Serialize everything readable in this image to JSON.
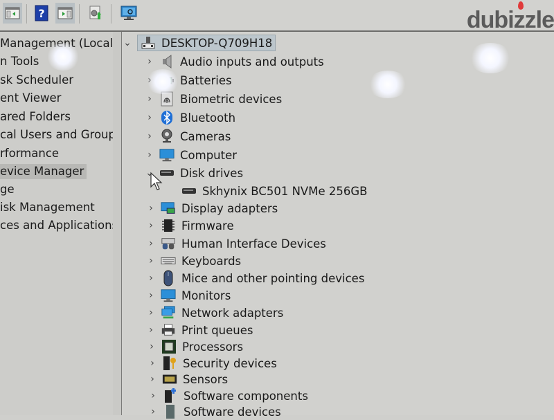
{
  "toolbar": {
    "buttons": [
      {
        "name": "show-hide-console-tree",
        "icon": "console-tree-icon"
      },
      {
        "name": "help",
        "icon": "help-icon"
      },
      {
        "name": "show-hide-action-pane",
        "icon": "action-pane-icon"
      },
      {
        "name": "update-driver",
        "icon": "update-driver-icon"
      },
      {
        "name": "scan-hardware-changes",
        "icon": "scan-hardware-icon"
      }
    ]
  },
  "watermark": "dubizzle",
  "left_tree": {
    "items": [
      {
        "label": "Management (Local)",
        "selected": false
      },
      {
        "label": "n Tools",
        "selected": false
      },
      {
        "label": "sk Scheduler",
        "selected": false
      },
      {
        "label": "ent Viewer",
        "selected": false
      },
      {
        "label": "ared Folders",
        "selected": false
      },
      {
        "label": "cal Users and Groups",
        "selected": false
      },
      {
        "label": "rformance",
        "selected": false
      },
      {
        "label": "evice Manager",
        "selected": true
      },
      {
        "label": "ge",
        "selected": false
      },
      {
        "label": "isk Management",
        "selected": false
      },
      {
        "label": "ces and Applications",
        "selected": false
      }
    ]
  },
  "device_tree": {
    "root": {
      "label": "DESKTOP-Q709H18",
      "expanded": true,
      "icon": "computer-root-icon"
    },
    "categories": [
      {
        "label": "Audio inputs and outputs",
        "icon": "speaker-icon",
        "expanded": false
      },
      {
        "label": "Batteries",
        "icon": "battery-icon",
        "expanded": false
      },
      {
        "label": "Biometric devices",
        "icon": "fingerprint-icon",
        "expanded": false
      },
      {
        "label": "Bluetooth",
        "icon": "bluetooth-icon",
        "expanded": false
      },
      {
        "label": "Cameras",
        "icon": "webcam-icon",
        "expanded": false
      },
      {
        "label": "Computer",
        "icon": "monitor-icon",
        "expanded": false
      },
      {
        "label": "Disk drives",
        "icon": "disk-drive-icon",
        "expanded": true,
        "children": [
          {
            "label": "Skhynix BC501 NVMe 256GB",
            "icon": "disk-drive-icon"
          }
        ]
      },
      {
        "label": "Display adapters",
        "icon": "display-adapter-icon",
        "expanded": false
      },
      {
        "label": "Firmware",
        "icon": "chip-icon",
        "expanded": false
      },
      {
        "label": "Human Interface Devices",
        "icon": "hid-icon",
        "expanded": false
      },
      {
        "label": "Keyboards",
        "icon": "keyboard-icon",
        "expanded": false
      },
      {
        "label": "Mice and other pointing devices",
        "icon": "mouse-icon",
        "expanded": false
      },
      {
        "label": "Monitors",
        "icon": "monitor-icon",
        "expanded": false
      },
      {
        "label": "Network adapters",
        "icon": "network-icon",
        "expanded": false
      },
      {
        "label": "Print queues",
        "icon": "printer-icon",
        "expanded": false
      },
      {
        "label": "Processors",
        "icon": "processor-icon",
        "expanded": false
      },
      {
        "label": "Security devices",
        "icon": "security-key-icon",
        "expanded": false
      },
      {
        "label": "Sensors",
        "icon": "sensor-icon",
        "expanded": false
      },
      {
        "label": "Software components",
        "icon": "software-component-icon",
        "expanded": false
      },
      {
        "label": "Software devices",
        "icon": "software-device-icon",
        "expanded": false
      }
    ]
  }
}
